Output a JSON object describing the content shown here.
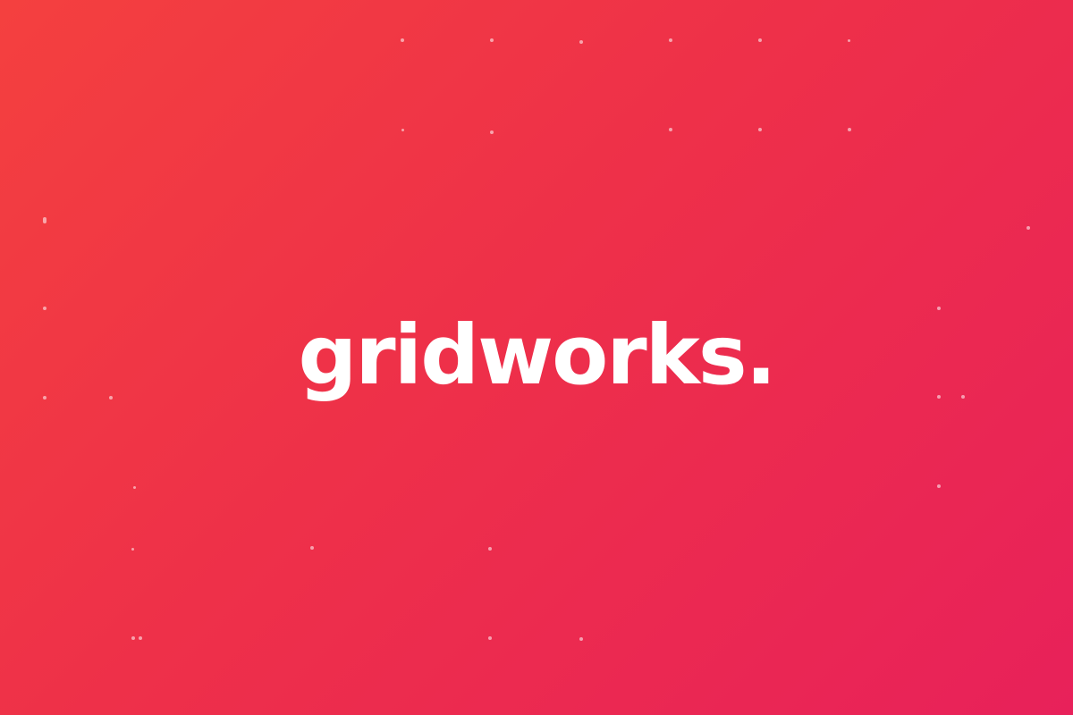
{
  "brand": {
    "name": "gridworks."
  },
  "theme": {
    "gradient_start": "#f4403f",
    "gradient_end": "#e8215a",
    "text_color": "#ffffff"
  }
}
